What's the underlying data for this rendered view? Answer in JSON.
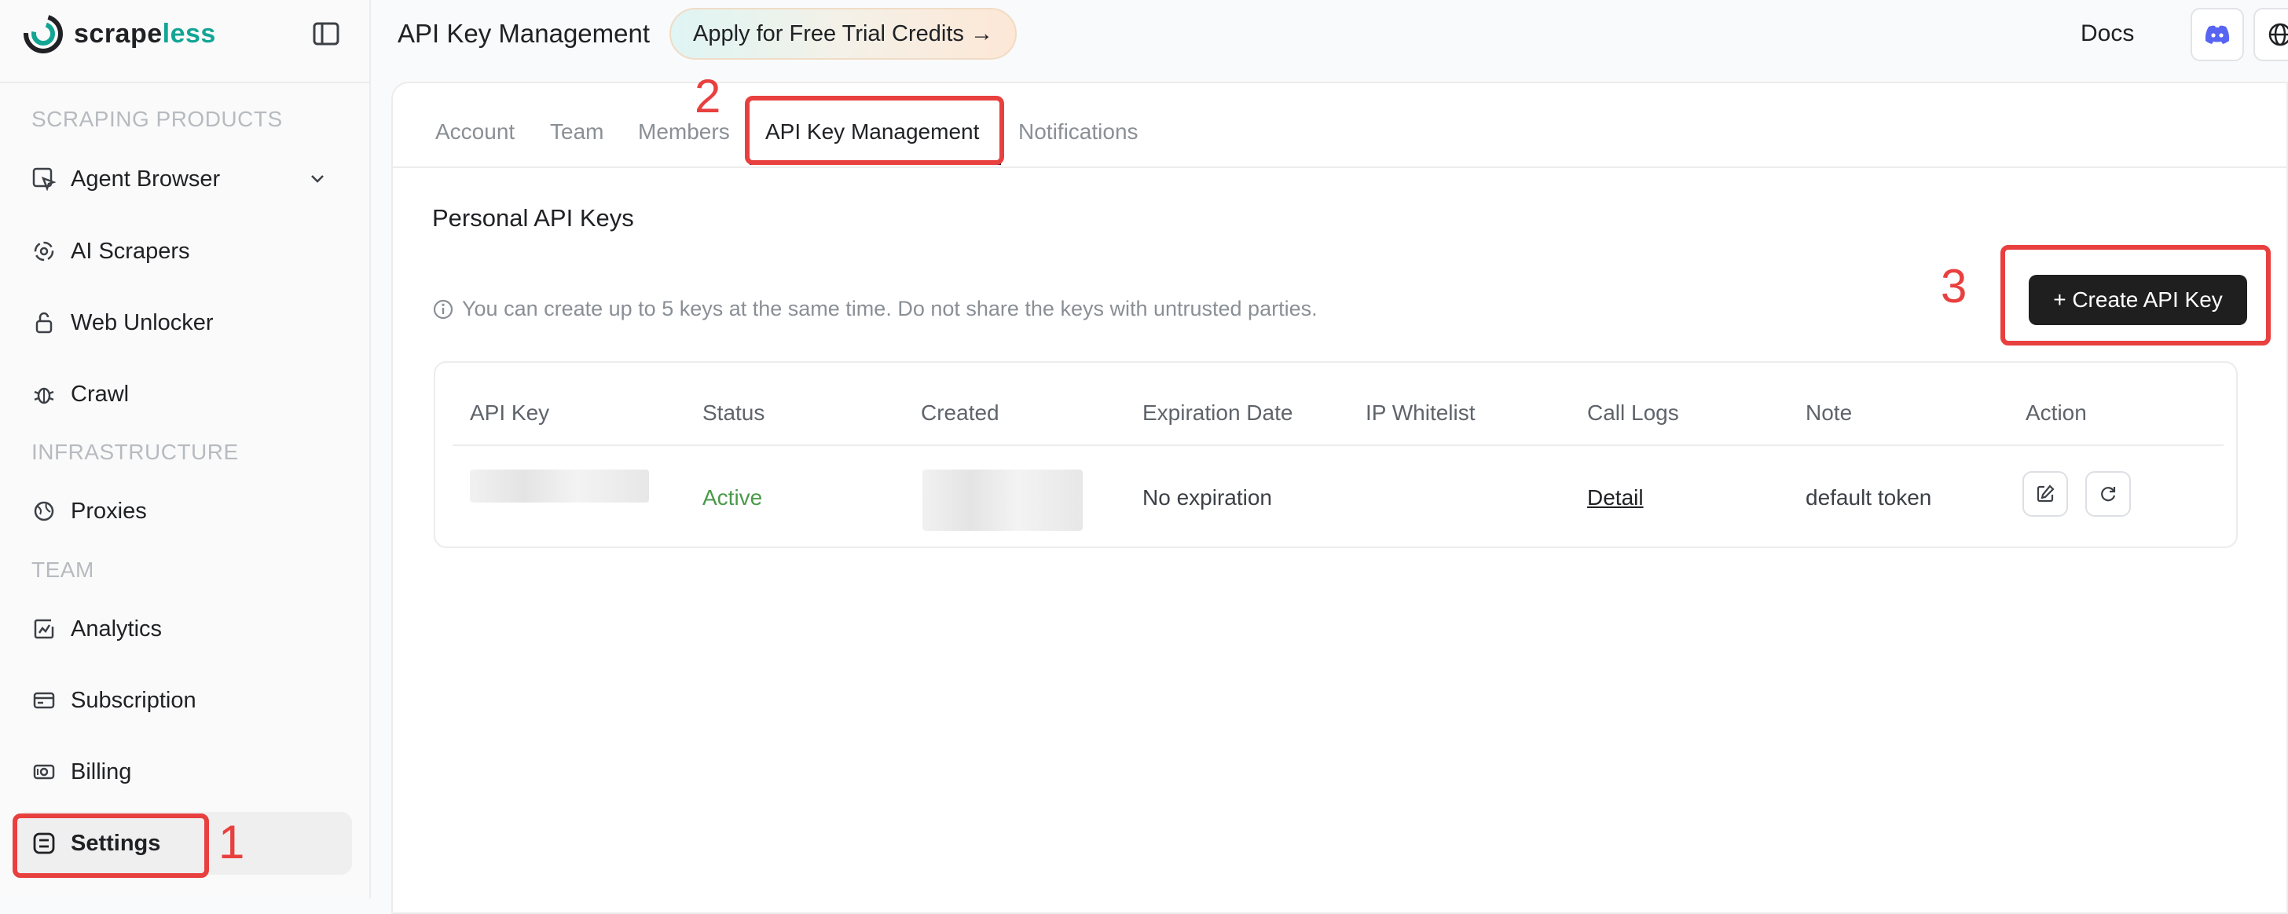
{
  "brand": {
    "name_prefix": "scrape",
    "name_suffix": "less",
    "accent_color": "#12a594"
  },
  "sidebar": {
    "sections": {
      "scraping_products": "SCRAPING PRODUCTS",
      "infrastructure": "INFRASTRUCTURE",
      "team": "TEAM"
    },
    "items": [
      {
        "label": "Agent Browser",
        "icon": "cursor-window-icon"
      },
      {
        "label": "AI Scrapers",
        "icon": "ai-target-icon"
      },
      {
        "label": "Web Unlocker",
        "icon": "unlock-icon"
      },
      {
        "label": "Crawl",
        "icon": "bug-icon"
      },
      {
        "label": "Proxies",
        "icon": "globe-icon"
      },
      {
        "label": "Analytics",
        "icon": "chart-icon"
      },
      {
        "label": "Subscription",
        "icon": "card-icon"
      },
      {
        "label": "Billing",
        "icon": "billing-icon"
      },
      {
        "label": "Settings",
        "icon": "settings-icon",
        "active": true
      }
    ]
  },
  "header": {
    "title": "API Key Management",
    "trial_button": "Apply for Free Trial Credits →",
    "docs": "Docs"
  },
  "tabs": [
    "Account",
    "Team",
    "Members",
    "API Key Management",
    "Notifications"
  ],
  "active_tab": "API Key Management",
  "main": {
    "section_title": "Personal API Keys",
    "info_text": "You can create up to 5 keys at the same time. Do not share the keys with untrusted parties.",
    "create_button": "+ Create API Key"
  },
  "table": {
    "headers": [
      "API Key",
      "Status",
      "Created",
      "Expiration Date",
      "IP Whitelist",
      "Call Logs",
      "Note",
      "Action"
    ],
    "rows": [
      {
        "api_key": "",
        "status": "Active",
        "created": "",
        "expiration": "No expiration",
        "ip_whitelist": "",
        "call_logs": "Detail",
        "note": "default token"
      }
    ]
  },
  "annotations": [
    "1",
    "2",
    "3"
  ],
  "colors": {
    "highlight": "#e8403f",
    "status_active": "#4a9a4a",
    "button_dark": "#1f1f1f"
  }
}
